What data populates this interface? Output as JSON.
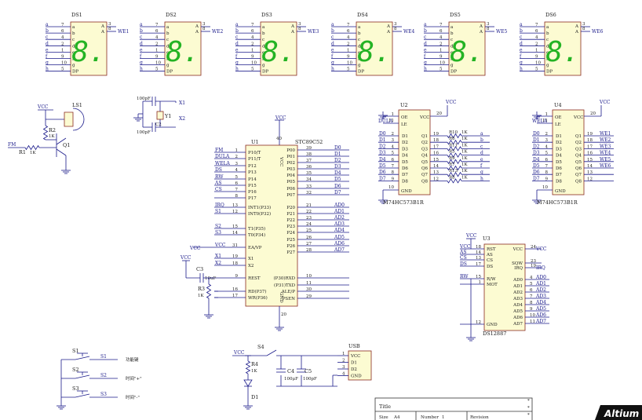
{
  "displays": [
    {
      "ref": "DS1",
      "we": "WE1"
    },
    {
      "ref": "DS2",
      "we": "WE2"
    },
    {
      "ref": "DS3",
      "we": "WE3"
    },
    {
      "ref": "DS4",
      "we": "WE4"
    },
    {
      "ref": "DS5",
      "we": "WE5"
    },
    {
      "ref": "DS6",
      "we": "WE6"
    }
  ],
  "display_pins": {
    "left_labels": [
      "a",
      "b",
      "c",
      "d",
      "e",
      "f",
      "g",
      "h"
    ],
    "left_nums": [
      "7",
      "6",
      "4",
      "2",
      "1",
      "9",
      "10",
      "5"
    ],
    "inner": [
      "a",
      "b",
      "c",
      "d",
      "e",
      "f",
      "g",
      "DP"
    ],
    "right_top": [
      "A",
      "A"
    ],
    "right_nums": [
      "3",
      "8"
    ],
    "digit": "8."
  },
  "buzzer": {
    "vcc": "VCC",
    "ls": "LS1",
    "r2": "R2",
    "r2v": "1K",
    "fm": "FM",
    "r1": "R1",
    "r1v": "1K",
    "q1": "Q1"
  },
  "crystal": {
    "c1": "100pF",
    "c2": "100pF",
    "c2ref": "C2",
    "y1": "Y1",
    "x1": "X1",
    "x2": "X2"
  },
  "mcu": {
    "ref": "U1",
    "part": "STC89C52",
    "vcc_top": "VCC",
    "vcc_pin": "40",
    "left_pins": [
      {
        "num": "1",
        "name": "P10/T",
        "net": "FM"
      },
      {
        "num": "2",
        "name": "P11/T",
        "net": "DULA"
      },
      {
        "num": "3",
        "name": "P12",
        "net": "WELA"
      },
      {
        "num": "4",
        "name": "P13",
        "net": "DS"
      },
      {
        "num": "5",
        "name": "P14",
        "net": "RW"
      },
      {
        "num": "6",
        "name": "P15",
        "net": "AS"
      },
      {
        "num": "7",
        "name": "P16",
        "net": "CS"
      },
      {
        "num": "8",
        "name": "P17",
        "net": ""
      },
      {
        "num": "13",
        "name": "INT1(P33)",
        "net": "IRQ"
      },
      {
        "num": "12",
        "name": "INT0(P32)",
        "net": "S1"
      },
      {
        "num": "15",
        "name": "T1(P35)",
        "net": "S2"
      },
      {
        "num": "14",
        "name": "T0(P34)",
        "net": "S3"
      },
      {
        "num": "31",
        "name": "EA/VP",
        "net": "VCC"
      },
      {
        "num": "19",
        "name": "X1",
        "net": "X1"
      },
      {
        "num": "18",
        "name": "X2",
        "net": "X2"
      },
      {
        "num": "9",
        "name": "REST",
        "net": ""
      },
      {
        "num": "16",
        "name": "RD(P37)",
        "net": ""
      },
      {
        "num": "17",
        "name": "WR(P36)",
        "net": ""
      }
    ],
    "right_pins": [
      {
        "num": "39",
        "name": "P00",
        "net": "D0"
      },
      {
        "num": "38",
        "name": "P01",
        "net": "D1"
      },
      {
        "num": "37",
        "name": "P02",
        "net": "D2"
      },
      {
        "num": "36",
        "name": "P03",
        "net": "D3"
      },
      {
        "num": "35",
        "name": "P04",
        "net": "D4"
      },
      {
        "num": "34",
        "name": "P05",
        "net": "D5"
      },
      {
        "num": "33",
        "name": "P06",
        "net": "D6"
      },
      {
        "num": "32",
        "name": "P07",
        "net": "D7"
      },
      {
        "num": "21",
        "name": "P20",
        "net": "AD0"
      },
      {
        "num": "22",
        "name": "P21",
        "net": "AD1"
      },
      {
        "num": "23",
        "name": "P22",
        "net": "AD2"
      },
      {
        "num": "24",
        "name": "P23",
        "net": "AD3"
      },
      {
        "num": "25",
        "name": "P24",
        "net": "AD4"
      },
      {
        "num": "26",
        "name": "P25",
        "net": "AD5"
      },
      {
        "num": "27",
        "name": "P26",
        "net": "AD6"
      },
      {
        "num": "28",
        "name": "P27",
        "net": "AD7"
      },
      {
        "num": "10",
        "name": "(P30)RXD",
        "net": ""
      },
      {
        "num": "11",
        "name": "(P31)TXD",
        "net": ""
      },
      {
        "num": "30",
        "name": "ALE/P",
        "net": ""
      },
      {
        "num": "29",
        "name": "PSEN",
        "net": ""
      }
    ],
    "gnd_pin": "20",
    "gnd": "GND"
  },
  "reset": {
    "vcc": "VCC",
    "c3": "C3",
    "c3v": "10uF",
    "r3": "R3",
    "r3v": "1K"
  },
  "latch_u2": {
    "ref": "U2",
    "part": "M74HC573B1R",
    "oe": "OE",
    "le": "LE",
    "vcc": "VCC",
    "le_net": "DULA",
    "vcc_num": "20",
    "vcc_net": "VCC",
    "gnd": "GND",
    "gnd_num": "10",
    "oe_num": "1",
    "le_num": "11",
    "d_nets": [
      "D0",
      "D1",
      "D2",
      "D3",
      "D4",
      "D5",
      "D6",
      "D7"
    ],
    "d_nums": [
      "2",
      "3",
      "4",
      "5",
      "6",
      "7",
      "8",
      "9"
    ],
    "d_names": [
      "D1",
      "D2",
      "D3",
      "D4",
      "D5",
      "D6",
      "D7",
      "D8"
    ],
    "q_names": [
      "Q1",
      "Q2",
      "Q3",
      "Q4",
      "Q5",
      "Q6",
      "Q7",
      "Q8"
    ],
    "q_nums": [
      "19",
      "18",
      "17",
      "16",
      "15",
      "14",
      "13",
      "12"
    ],
    "res": [
      "R10",
      "R6",
      "R11",
      "R5",
      "R9",
      "R7",
      "R13",
      "R8"
    ],
    "res_val": "1K",
    "out_nets": [
      "a",
      "b",
      "c",
      "d",
      "e",
      "f",
      "g",
      "h"
    ]
  },
  "latch_u4": {
    "ref": "U4",
    "part": "M74HC573B1R",
    "oe": "OE",
    "le": "LE",
    "vcc": "VCC",
    "le_net": "WELA",
    "vcc_num": "20",
    "vcc_net": "VCC",
    "gnd": "GND",
    "gnd_num": "10",
    "oe_num": "1",
    "le_num": "11",
    "d_nets": [
      "D0",
      "D1",
      "D2",
      "D3",
      "D4",
      "D5",
      "D6",
      "D7"
    ],
    "d_nums": [
      "2",
      "3",
      "4",
      "5",
      "6",
      "7",
      "8",
      "9"
    ],
    "d_names": [
      "D1",
      "D2",
      "D3",
      "D4",
      "D5",
      "D6",
      "D7",
      "D8"
    ],
    "q_names": [
      "Q1",
      "Q2",
      "Q3",
      "Q4",
      "Q5",
      "Q6",
      "Q7",
      "Q8"
    ],
    "q_nums": [
      "19",
      "18",
      "17",
      "16",
      "15",
      "14",
      "13",
      "12"
    ],
    "out_nets": [
      "WE1",
      "WE2",
      "WE3",
      "WE4",
      "WE5",
      "WE6",
      "",
      ""
    ]
  },
  "rtc_u3": {
    "ref": "U3",
    "part": "DS12887",
    "vcc": "VCC",
    "left_pins": [
      {
        "num": "18",
        "name": "RST",
        "net": "VCC"
      },
      {
        "num": "14",
        "name": "AS",
        "net": "AS"
      },
      {
        "num": "13",
        "name": "CS",
        "net": "CS"
      },
      {
        "num": "17",
        "name": "DS",
        "net": "DS"
      },
      {
        "num": "15",
        "name": "R/W",
        "net": "RW"
      },
      {
        "num": "1",
        "name": "MOT",
        "net": ""
      },
      {
        "num": "12",
        "name": "GND",
        "net": ""
      }
    ],
    "right_top": [
      {
        "num": "24",
        "name": "VCC",
        "net": "VCC"
      },
      {
        "num": "23",
        "name": "SQW",
        "net": ""
      },
      {
        "num": "19",
        "name": "IRQ",
        "net": "IRQ"
      }
    ],
    "ad_names": [
      "AD0",
      "AD1",
      "AD2",
      "AD3",
      "AD4",
      "AD5",
      "AD6",
      "AD7"
    ],
    "ad_nums": [
      "4",
      "5",
      "6",
      "7",
      "8",
      "9",
      "10",
      "11"
    ]
  },
  "buttons": [
    {
      "ref": "S1",
      "net": "S1",
      "note": "功能键"
    },
    {
      "ref": "S2",
      "net": "S2",
      "note": "时间\"+\""
    },
    {
      "ref": "S3",
      "net": "S3",
      "note": "时间\"-\""
    }
  ],
  "power": {
    "vcc": "VCC",
    "s4": "S4",
    "r4": "R4",
    "r4v": "1K",
    "d1": "D1",
    "c4": "C4",
    "c4v": "100μF",
    "c5": "C5",
    "c5v": "100pF",
    "usb": "USB",
    "usb_pins": [
      "VCC",
      "D1",
      "D2",
      "GND"
    ],
    "usb_nums": [
      "1",
      "2",
      "3",
      "4"
    ]
  },
  "title_block": {
    "title": "Title",
    "size": "Size",
    "size_val": "A4",
    "number": "Number",
    "number_val": "1",
    "revision": "Revision"
  },
  "logo": "Altium"
}
